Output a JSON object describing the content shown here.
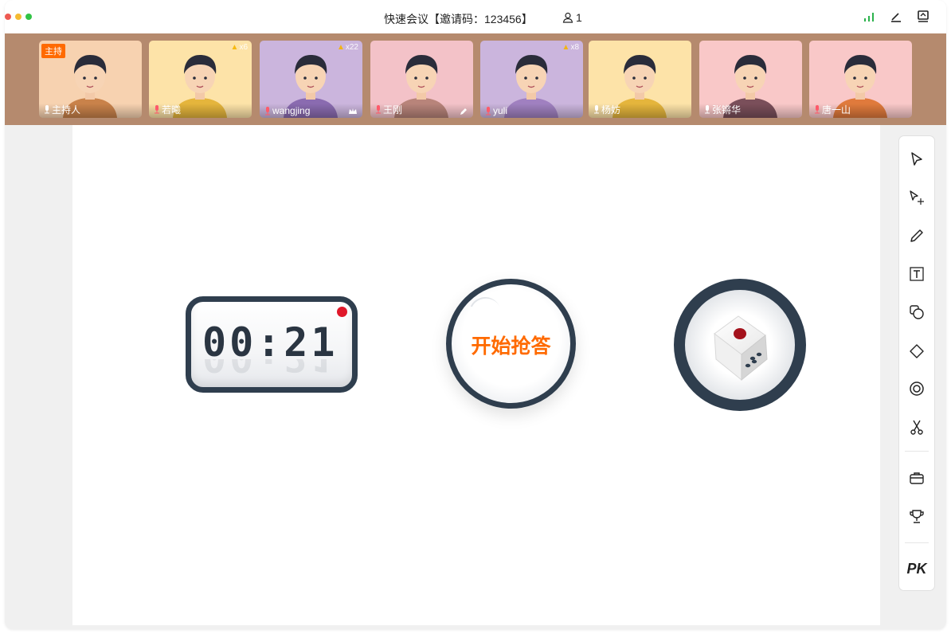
{
  "window": {
    "title": "快速会议【邀请码：123456】",
    "participant_count": "1"
  },
  "participants": [
    {
      "name": "主持人",
      "host_tag": "主持",
      "bg": "#f7d2b0",
      "likes": ""
    },
    {
      "name": "若曦",
      "bg": "#fde3a8",
      "likes": "x6"
    },
    {
      "name": "wangjing",
      "bg": "#cbb5dd",
      "likes": "x22"
    },
    {
      "name": "王刚",
      "bg": "#f3c2c8",
      "likes": ""
    },
    {
      "name": "yuli",
      "bg": "#cbb5dd",
      "likes": "x8"
    },
    {
      "name": "杨妨",
      "bg": "#fde3a8",
      "likes": ""
    },
    {
      "name": "张锵华",
      "bg": "#f9c8c8",
      "likes": ""
    },
    {
      "name": "唐一山",
      "bg": "#f9c8c8",
      "likes": ""
    }
  ],
  "widgets": {
    "timer": "00:21",
    "buzzer_label": "开始抢答"
  },
  "toolbar": {
    "pk_label": "PK",
    "tools": [
      "select-icon",
      "multi-select-icon",
      "pen-icon",
      "text-icon",
      "shape-icon",
      "eraser-icon",
      "laser-icon",
      "scissors-icon",
      "toolbox-icon",
      "trophy-icon"
    ]
  },
  "colors": {
    "accent": "#ff6a00",
    "strip": "#b58a6e",
    "dark_ring": "#2f3e4e",
    "record": "#e0182a",
    "signal": "#2bb24c"
  }
}
